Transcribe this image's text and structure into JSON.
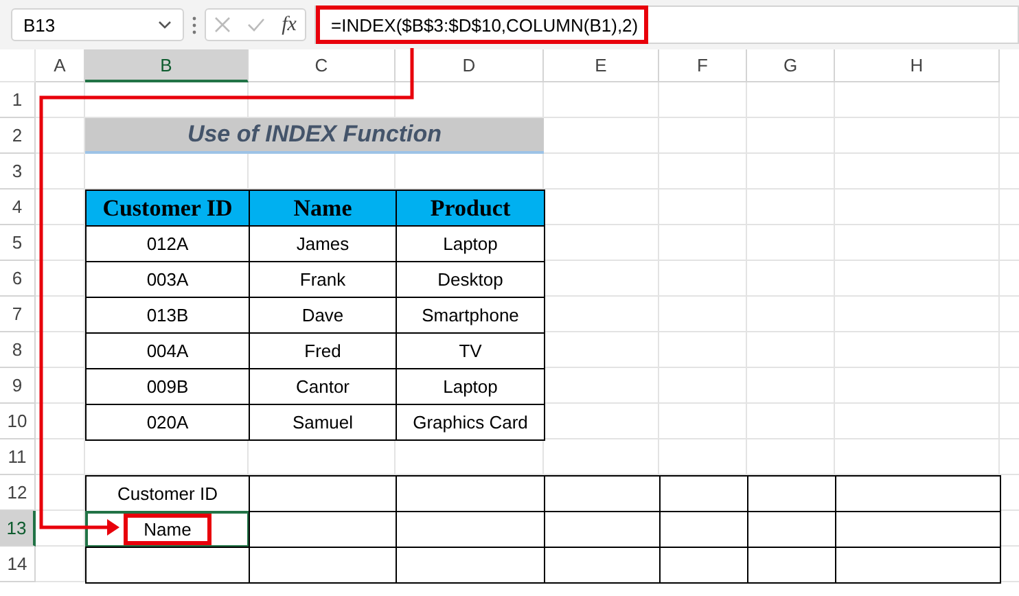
{
  "name_box": {
    "value": "B13"
  },
  "formula_bar": {
    "fx": "fx",
    "formula": "=INDEX($B$3:$D$10,COLUMN(B1),2)"
  },
  "columns": [
    {
      "letter": "A",
      "selected": false
    },
    {
      "letter": "B",
      "selected": true
    },
    {
      "letter": "C",
      "selected": false
    },
    {
      "letter": "D",
      "selected": false
    },
    {
      "letter": "E",
      "selected": false
    },
    {
      "letter": "F",
      "selected": false
    },
    {
      "letter": "G",
      "selected": false
    },
    {
      "letter": "H",
      "selected": false
    }
  ],
  "rows": [
    {
      "number": "1",
      "selected": false
    },
    {
      "number": "2",
      "selected": false
    },
    {
      "number": "3",
      "selected": false
    },
    {
      "number": "4",
      "selected": false
    },
    {
      "number": "5",
      "selected": false
    },
    {
      "number": "6",
      "selected": false
    },
    {
      "number": "7",
      "selected": false
    },
    {
      "number": "8",
      "selected": false
    },
    {
      "number": "9",
      "selected": false
    },
    {
      "number": "10",
      "selected": false
    },
    {
      "number": "11",
      "selected": false
    },
    {
      "number": "12",
      "selected": false
    },
    {
      "number": "13",
      "selected": true
    },
    {
      "number": "14",
      "selected": false
    }
  ],
  "title": "Use of INDEX Function",
  "table": {
    "columns": [
      "Customer ID",
      "Name",
      "Product"
    ],
    "rows": [
      [
        "012A",
        "James",
        "Laptop"
      ],
      [
        "003A",
        "Frank",
        "Desktop"
      ],
      [
        "013B",
        "Dave",
        "Smartphone"
      ],
      [
        "004A",
        "Fred",
        "TV"
      ],
      [
        "009B",
        "Cantor",
        "Laptop"
      ],
      [
        "020A",
        "Samuel",
        "Graphics Card"
      ]
    ]
  },
  "lookup": {
    "rows": [
      {
        "label": "Customer ID",
        "selected": false
      },
      {
        "label": "Name",
        "selected": true
      },
      {
        "selected": false
      }
    ]
  }
}
